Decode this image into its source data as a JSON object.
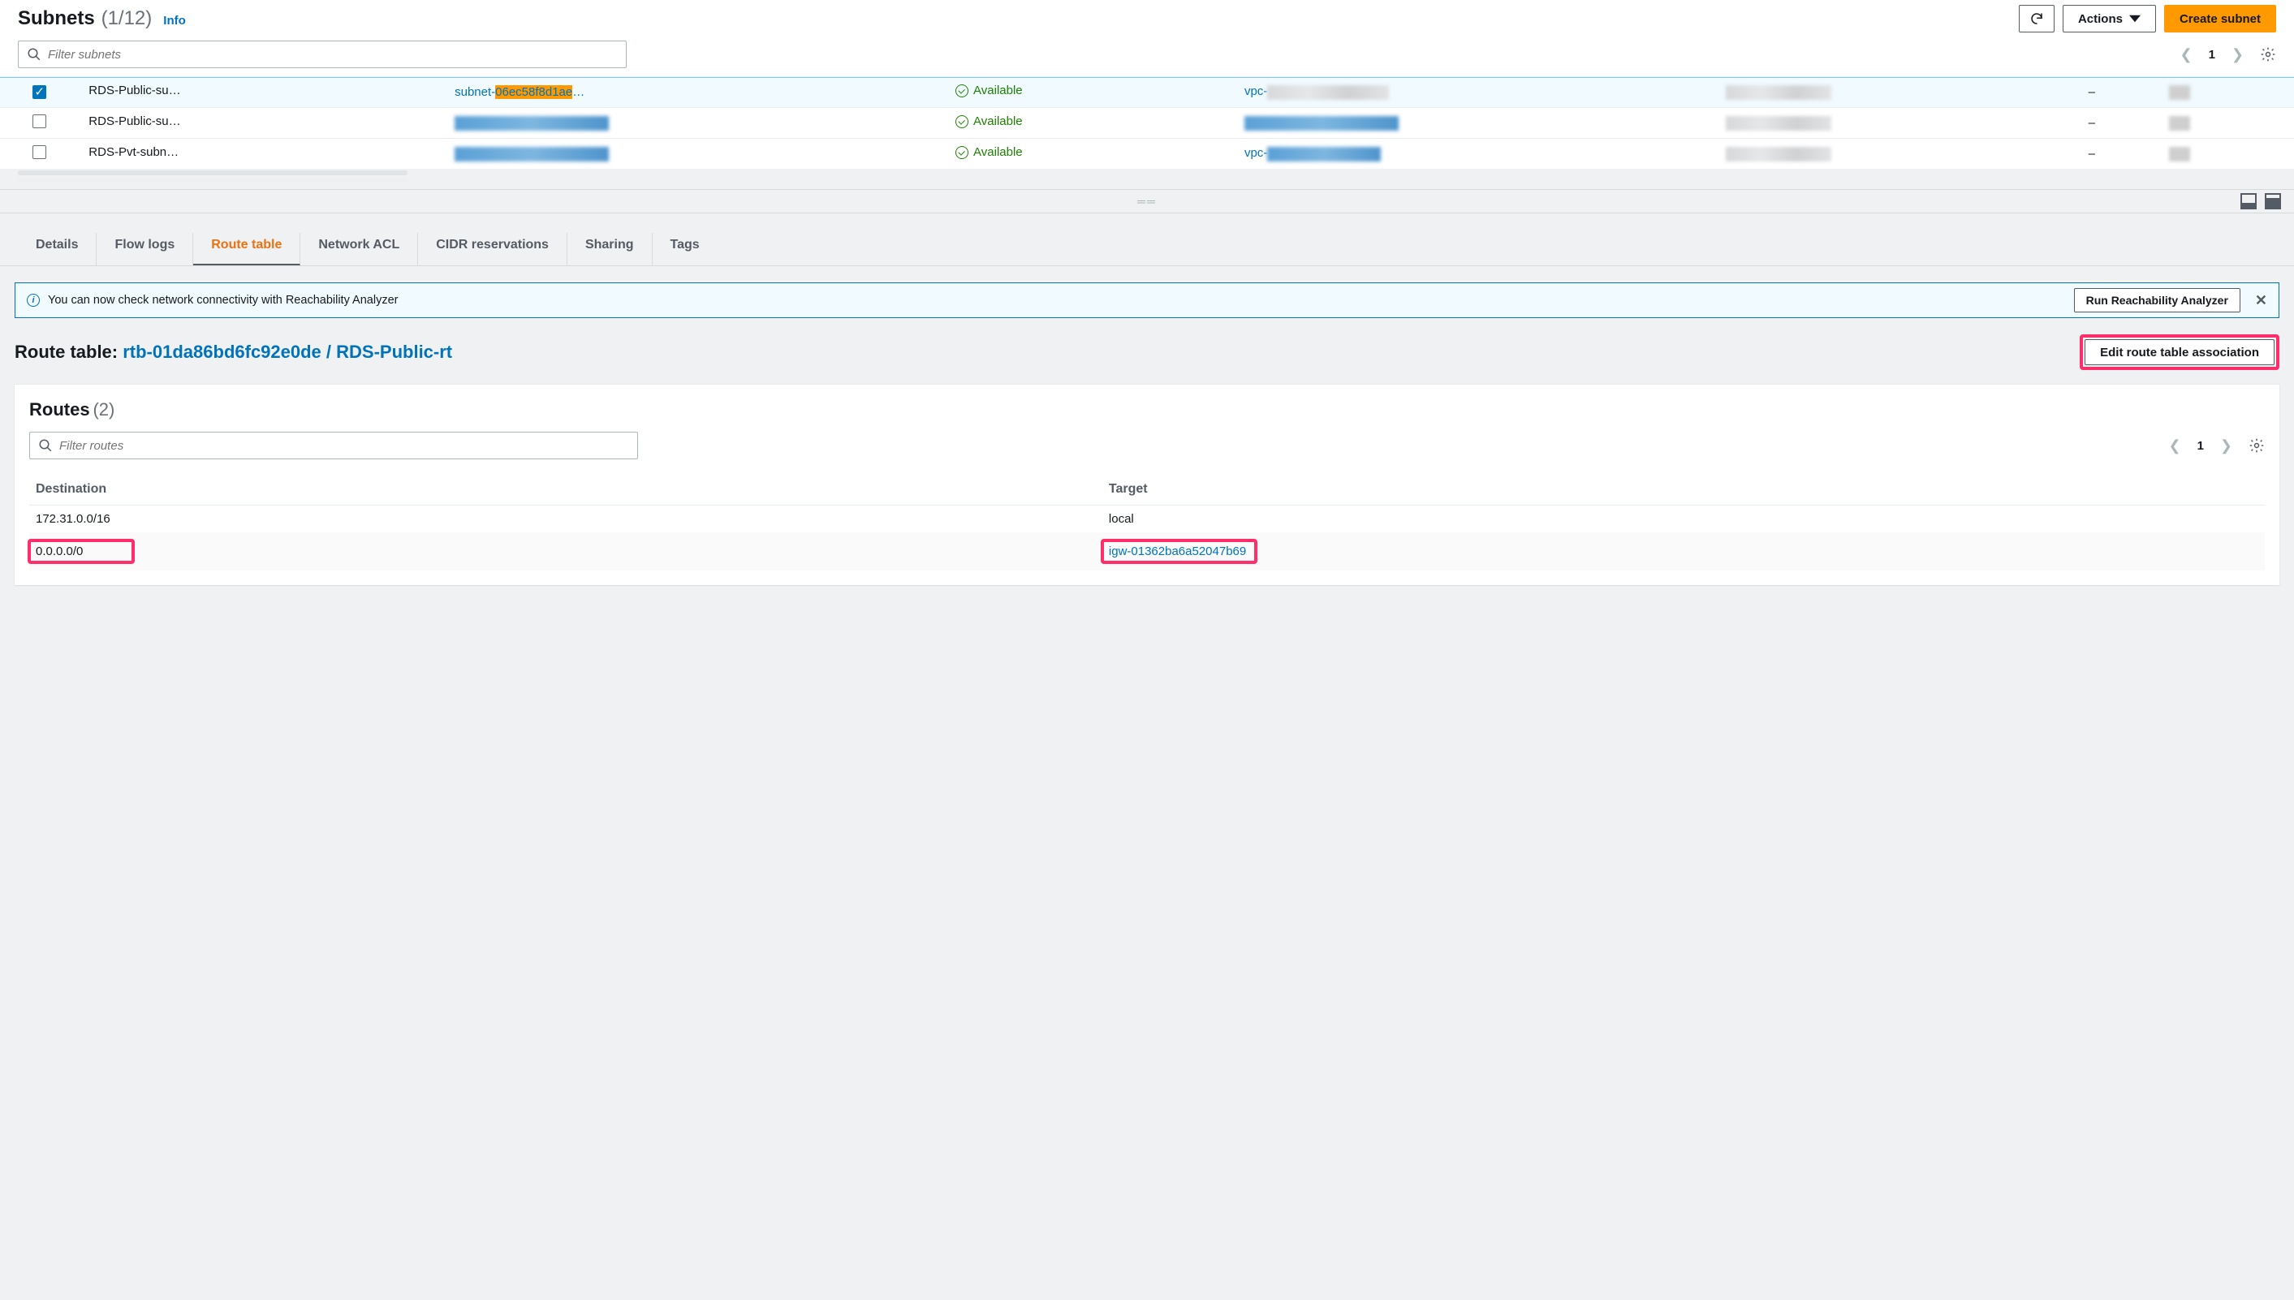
{
  "header": {
    "title": "Subnets",
    "count": "(1/12)",
    "info_label": "Info",
    "actions_label": "Actions",
    "create_label": "Create subnet"
  },
  "filter": {
    "placeholder": "Filter subnets",
    "page": "1"
  },
  "subnets": {
    "rows": [
      {
        "name": "RDS-Public-su…",
        "id_prefix": "subnet-",
        "id_hl": "06ec58f8d1ae",
        "id_suffix": "…",
        "state": "Available",
        "vpc_prefix": "vpc-",
        "dash": "–"
      },
      {
        "name": "RDS-Public-su…",
        "state": "Available",
        "dash": "–"
      },
      {
        "name": "RDS-Pvt-subn…",
        "state": "Available",
        "vpc_prefix": "vpc-",
        "dash": "–"
      }
    ]
  },
  "tabs": {
    "items": [
      "Details",
      "Flow logs",
      "Route table",
      "Network ACL",
      "CIDR reservations",
      "Sharing",
      "Tags"
    ]
  },
  "banner": {
    "text": "You can now check network connectivity with Reachability Analyzer",
    "button": "Run Reachability Analyzer"
  },
  "rt": {
    "label": "Route table: ",
    "link": "rtb-01da86bd6fc92e0de / RDS-Public-rt",
    "edit_btn": "Edit route table association"
  },
  "routes": {
    "title": "Routes",
    "count": "(2)",
    "filter_placeholder": "Filter routes",
    "page": "1",
    "cols": {
      "dest": "Destination",
      "target": "Target"
    },
    "rows": [
      {
        "dest": "172.31.0.0/16",
        "target": "local",
        "target_link": false
      },
      {
        "dest": "0.0.0.0/0",
        "target": "igw-01362ba6a52047b69",
        "target_link": true
      }
    ]
  }
}
